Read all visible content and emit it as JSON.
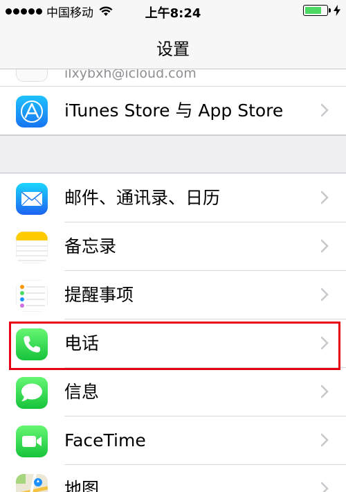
{
  "status_bar": {
    "carrier": "中国移动",
    "time": "上午8:24",
    "battery_percent": 75
  },
  "nav": {
    "title": "设置"
  },
  "account": {
    "email": "ilxybxh@icloud.com"
  },
  "section1": {
    "items": [
      {
        "label": "iTunes Store 与 App Store",
        "icon": "app-store-icon",
        "color": "#1a8cff"
      }
    ]
  },
  "section2": {
    "items": [
      {
        "label": "邮件、通讯录、日历",
        "icon": "mail-icon",
        "color": "#1e90ff"
      },
      {
        "label": "备忘录",
        "icon": "notes-icon",
        "color": "#ffcc00"
      },
      {
        "label": "提醒事项",
        "icon": "reminders-icon",
        "color": "#ffffff"
      },
      {
        "label": "电话",
        "icon": "phone-icon",
        "color": "#4cd964"
      },
      {
        "label": "信息",
        "icon": "messages-icon",
        "color": "#4cd964"
      },
      {
        "label": "FaceTime",
        "icon": "facetime-icon",
        "color": "#4cd964"
      },
      {
        "label": "地图",
        "icon": "maps-icon",
        "color": "#e8e4d8"
      }
    ]
  },
  "highlight": {
    "item": "电话",
    "color": "#e60012"
  }
}
